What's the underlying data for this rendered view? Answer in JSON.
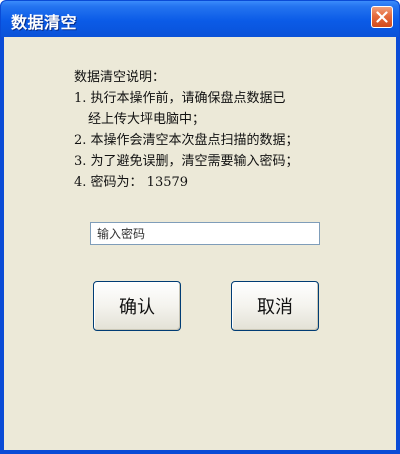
{
  "window": {
    "title": "数据清空"
  },
  "instructions": {
    "heading": "数据清空说明：",
    "items": [
      "1. 执行本操作前，请确保盘点数据已",
      "经上传大坪电脑中；",
      "2. 本操作会清空本次盘点扫描的数据；",
      "3. 为了避免误删，清空需要输入密码；",
      "4. 密码为：  13579"
    ]
  },
  "password": {
    "placeholder": "输入密码",
    "value": ""
  },
  "buttons": {
    "confirm_label": "确认",
    "cancel_label": "取消"
  },
  "colors": {
    "titlebar": "#0b5be7",
    "client_bg": "#ece9d8",
    "close_btn": "#e56a3c"
  },
  "icons": {
    "close": "close-icon"
  }
}
